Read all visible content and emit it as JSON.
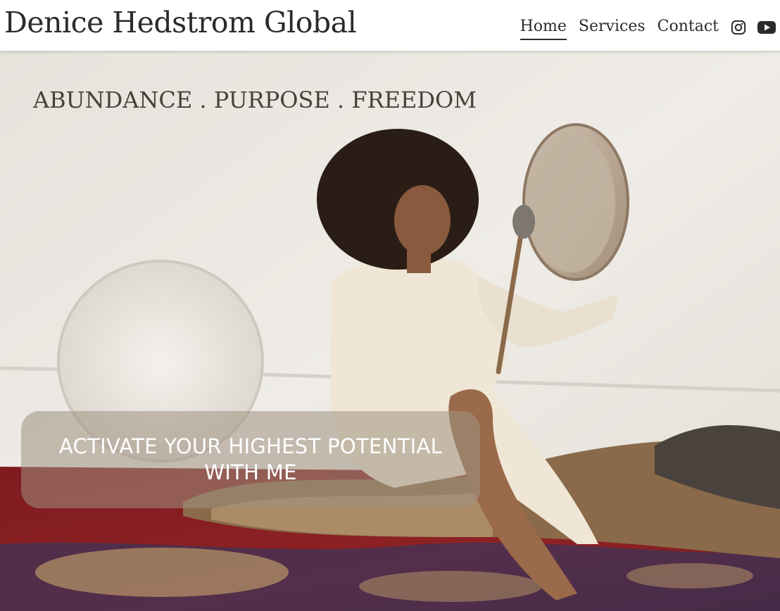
{
  "header": {
    "brand": "Denice Hedstrom Global",
    "nav": [
      {
        "label": "Home",
        "active": true
      },
      {
        "label": "Services",
        "active": false
      },
      {
        "label": "Contact",
        "active": false
      }
    ],
    "social": [
      "instagram-icon",
      "youtube-icon"
    ]
  },
  "hero": {
    "tagline": "ABUNDANCE . PURPOSE . FREEDOM",
    "cta": "ACTIVATE YOUR HIGHEST POTENTIAL WITH ME"
  },
  "colors": {
    "text": "#2b2b2b",
    "wall": "#ece9e4",
    "rug": "#8e1f23",
    "cta_overlay": "rgba(160,145,130,0.55)"
  }
}
